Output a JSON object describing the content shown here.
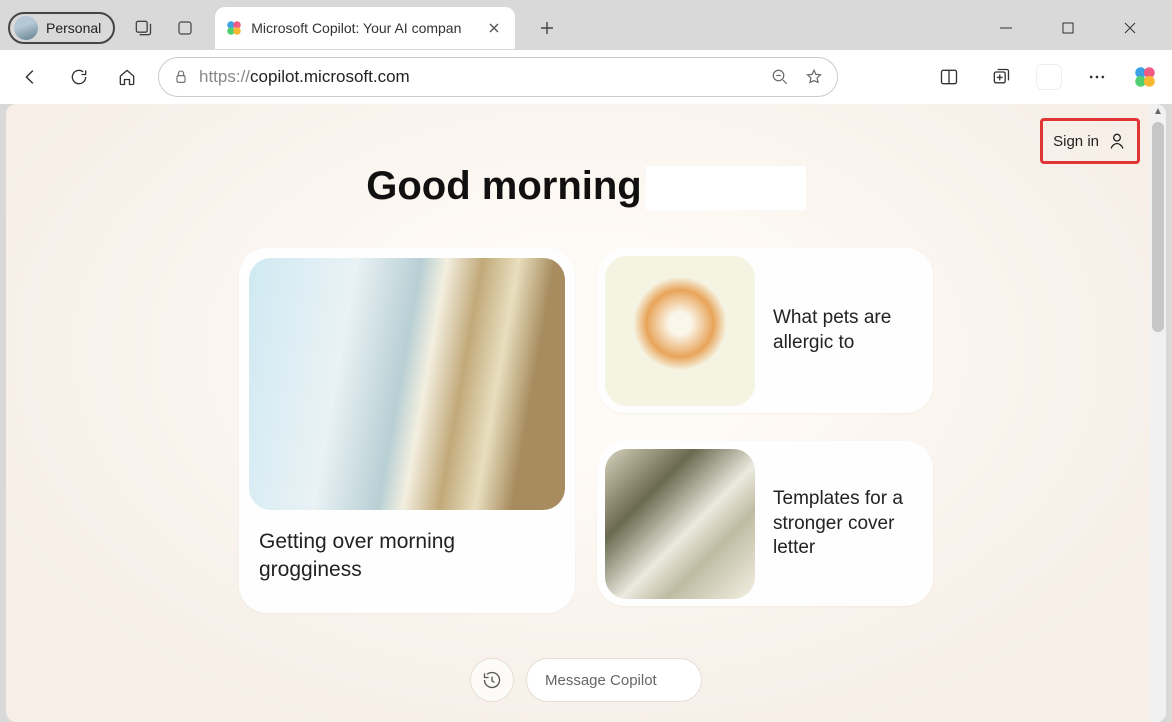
{
  "window": {
    "profile_label": "Personal",
    "tab_title": "Microsoft Copilot: Your AI compan",
    "url_protocol": "https://",
    "url_host": "copilot.microsoft.com"
  },
  "page": {
    "signin_label": "Sign in",
    "greeting": "Good morning",
    "cards": {
      "large": {
        "title": "Getting over morning grogginess"
      },
      "small1": {
        "title": "What pets are allergic to"
      },
      "small2": {
        "title": "Templates for a stronger cover letter"
      }
    },
    "composer_placeholder": "Message Copilot"
  },
  "highlight": {
    "target": "sign-in-button",
    "color": "#e03535"
  }
}
